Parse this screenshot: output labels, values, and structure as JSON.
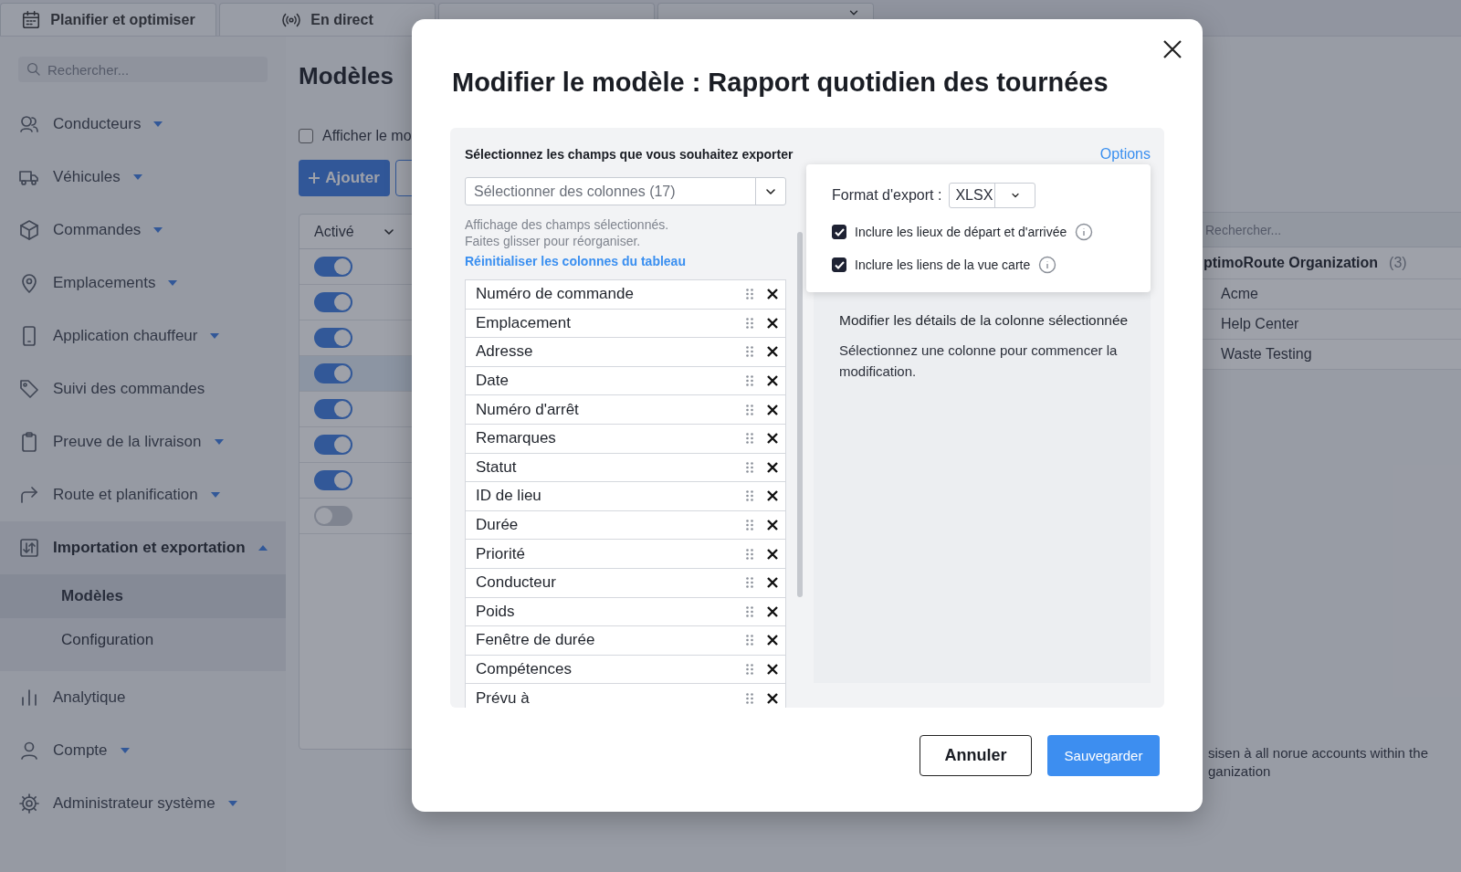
{
  "tabs": [
    {
      "label": "Planifier et optimiser"
    },
    {
      "label": "En direct"
    },
    {
      "dropdown": false
    },
    {
      "dropdown": true
    }
  ],
  "sidebar": {
    "search": {
      "placeholder": "Rechercher..."
    },
    "items": [
      {
        "label": "Conducteurs",
        "has_menu": true,
        "expanded": false
      },
      {
        "label": "Véhicules",
        "has_menu": true,
        "expanded": false
      },
      {
        "label": "Commandes",
        "has_menu": true,
        "expanded": false
      },
      {
        "label": "Emplacements",
        "has_menu": true,
        "expanded": false
      },
      {
        "label": "Application chauffeur",
        "has_menu": true,
        "expanded": false
      },
      {
        "label": "Suivi des commandes",
        "has_menu": false
      },
      {
        "label": "Preuve de la livraison",
        "has_menu": true,
        "expanded": false
      },
      {
        "label": "Route et planification",
        "has_menu": true,
        "expanded": false
      },
      {
        "label": "Importation et exportation",
        "has_menu": true,
        "expanded": true,
        "children": [
          {
            "label": "Modèles",
            "selected": true
          },
          {
            "label": "Configuration",
            "selected": false
          }
        ]
      },
      {
        "label": "Analytique",
        "has_menu": false
      },
      {
        "label": "Compte",
        "has_menu": true,
        "expanded": false
      },
      {
        "label": "Administrateur système",
        "has_menu": true,
        "expanded": false
      }
    ]
  },
  "page": {
    "title": "Modèles",
    "filter_checkbox": {
      "label": "Afficher le mo",
      "checked": false
    },
    "add_button": "Ajouter",
    "table": {
      "column": "Activé",
      "rows": [
        {
          "on": true,
          "selected": false
        },
        {
          "on": true,
          "selected": false
        },
        {
          "on": true,
          "selected": false
        },
        {
          "on": true,
          "selected": true
        },
        {
          "on": true,
          "selected": false
        },
        {
          "on": true,
          "selected": false
        },
        {
          "on": true,
          "selected": false
        },
        {
          "on": false,
          "selected": false
        }
      ]
    }
  },
  "side_panel": {
    "search": {
      "placeholder": "Rechercher..."
    },
    "group": {
      "name": "ptimoRoute Organization",
      "count": "(3)"
    },
    "items": [
      "Acme",
      "Help Center",
      "Waste Testing"
    ],
    "note_lines": [
      "sisen à all norue accounts within the",
      "ganization"
    ]
  },
  "modal": {
    "title": "Modifier le modèle : Rapport quotidien des tournées",
    "fields_label": "Sélectionnez les champs que vous souhaitez exporter",
    "options_link": "Options",
    "column_select": {
      "placeholder": "Sélectionner des colonnes (17)"
    },
    "hint_lines": [
      "Affichage des champs sélectionnés.",
      "Faites glisser pour réorganiser."
    ],
    "reset_link": "Réinitialiser les colonnes du tableau",
    "columns": [
      "Numéro de commande",
      "Emplacement",
      "Adresse",
      "Date",
      "Numéro d'arrêt",
      "Remarques",
      "Statut",
      "ID de lieu",
      "Durée",
      "Priorité",
      "Conducteur",
      "Poids",
      "Fenêtre de durée",
      "Compétences",
      "Prévu à"
    ],
    "options": {
      "format_label": "Format d'export :",
      "format": "XLSX",
      "checkboxes": [
        {
          "label": "Inclure les lieux de départ et d'arrivée",
          "checked": true
        },
        {
          "label": "Inclure les liens de la vue carte",
          "checked": true
        }
      ]
    },
    "details_title": "Modifier les détails de la colonne sélectionnée",
    "details_text": "Sélectionnez une colonne pour commencer la modification.",
    "cancel": "Annuler",
    "save": "Sauvegarder"
  }
}
